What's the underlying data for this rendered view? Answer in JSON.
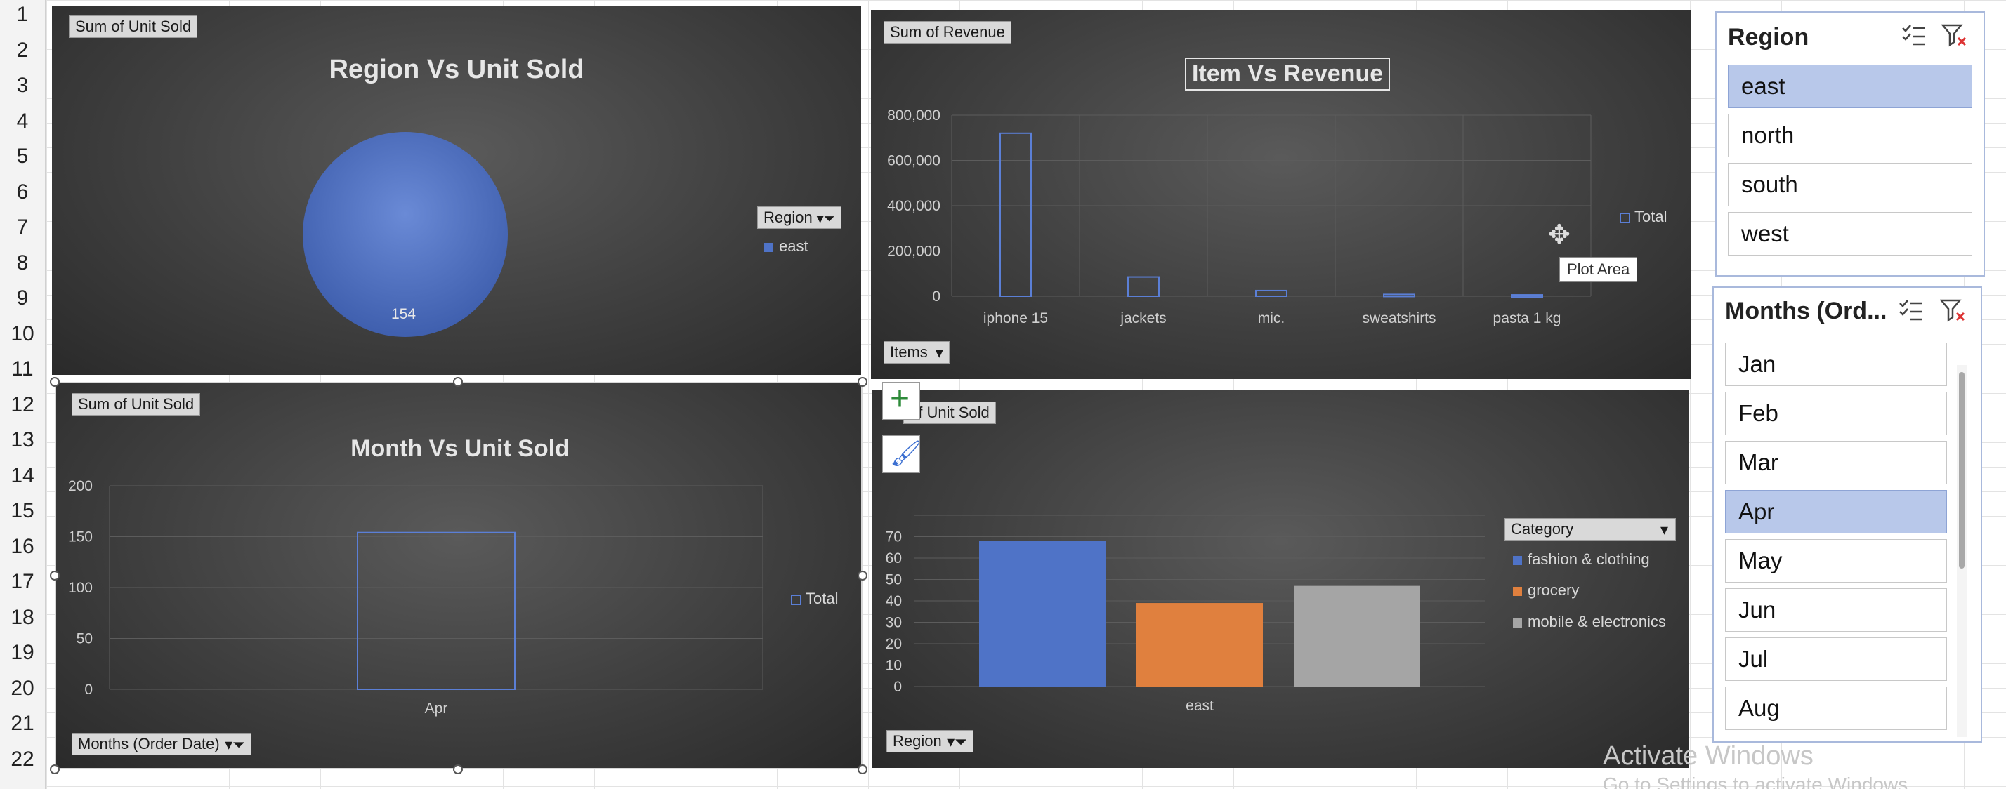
{
  "row_numbers": [
    "1",
    "2",
    "3",
    "4",
    "5",
    "6",
    "7",
    "8",
    "9",
    "10",
    "11",
    "12",
    "13",
    "14",
    "15",
    "16",
    "17",
    "18",
    "19",
    "20",
    "21",
    "22"
  ],
  "charts": {
    "region_pie": {
      "field_button": "Sum of Unit Sold",
      "title": "Region Vs Unit Sold",
      "legend_filter": "Region",
      "chart_data": {
        "type": "pie",
        "title": "Region Vs Unit Sold",
        "categories": [
          "east"
        ],
        "values": [
          154
        ],
        "data_labels": [
          "154"
        ],
        "colors": [
          "#4f73c7"
        ],
        "legend_placement": "right"
      }
    },
    "item_revenue": {
      "field_button": "Sum of Revenue",
      "title": "Item Vs Revenue",
      "axis_button": "Items",
      "legend_label": "Total",
      "tooltip": "Plot Area",
      "yticks": [
        "800,000",
        "600,000",
        "400,000",
        "200,000",
        "0"
      ],
      "chart_data": {
        "type": "bar",
        "title": "Item Vs Revenue",
        "categories": [
          "iphone 15",
          "jackets",
          "mic.",
          "sweatshirts",
          "pasta 1 kg"
        ],
        "series": [
          {
            "name": "Total",
            "values": [
              720000,
              85000,
              25000,
              8000,
              6000
            ]
          }
        ],
        "ylim": [
          0,
          800000
        ],
        "grid": true,
        "legend_placement": "right"
      }
    },
    "month_units": {
      "field_button": "Sum of Unit Sold",
      "title": "Month Vs Unit Sold",
      "axis_button": "Months (Order Date)",
      "legend_label": "Total",
      "yticks": [
        "200",
        "150",
        "100",
        "50",
        "0"
      ],
      "chart_data": {
        "type": "bar",
        "title": "Month Vs Unit Sold",
        "categories": [
          "Apr"
        ],
        "series": [
          {
            "name": "Total",
            "values": [
              154
            ]
          }
        ],
        "ylim": [
          0,
          200
        ],
        "grid": true,
        "legend_placement": "right"
      }
    },
    "category_units": {
      "field_button": "of Unit Sold",
      "axis_button": "Region",
      "legend_title": "Category",
      "yticks": [
        "70",
        "60",
        "50",
        "40",
        "30",
        "20",
        "10",
        "0"
      ],
      "chart_data": {
        "type": "bar",
        "categories": [
          "east"
        ],
        "series": [
          {
            "name": "fashion & clothing",
            "values": [
              68
            ],
            "color": "#4f73c7"
          },
          {
            "name": "grocery",
            "values": [
              39
            ],
            "color": "#e0803e"
          },
          {
            "name": "mobile & electronics",
            "values": [
              47
            ],
            "color": "#a5a5a5"
          }
        ],
        "ylim": [
          0,
          80
        ],
        "grid": true,
        "legend_placement": "right"
      }
    }
  },
  "slicers": {
    "region": {
      "title": "Region",
      "items": [
        {
          "label": "east",
          "selected": true
        },
        {
          "label": "north",
          "selected": false
        },
        {
          "label": "south",
          "selected": false
        },
        {
          "label": "west",
          "selected": false
        }
      ]
    },
    "months": {
      "title": "Months (Ord...",
      "items": [
        {
          "label": "Jan",
          "selected": false
        },
        {
          "label": "Feb",
          "selected": false
        },
        {
          "label": "Mar",
          "selected": false
        },
        {
          "label": "Apr",
          "selected": true
        },
        {
          "label": "May",
          "selected": false
        },
        {
          "label": "Jun",
          "selected": false
        },
        {
          "label": "Jul",
          "selected": false
        },
        {
          "label": "Aug",
          "selected": false
        }
      ]
    }
  },
  "watermark": {
    "line1": "Activate Windows",
    "line2": "Go to Settings to activate Windows."
  }
}
